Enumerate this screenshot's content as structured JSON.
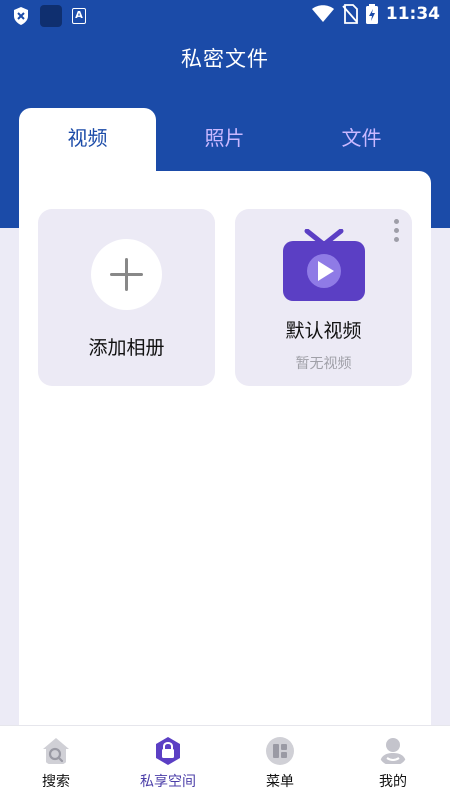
{
  "status_bar": {
    "time": "11:34",
    "icons": [
      "shield-x-icon",
      "app-square-icon",
      "a-box-icon",
      "wifi-icon",
      "no-sim-icon",
      "battery-charging-icon"
    ]
  },
  "header": {
    "title": "私密文件"
  },
  "tabs": [
    {
      "label": "视频",
      "active": true
    },
    {
      "label": "照片",
      "active": false
    },
    {
      "label": "文件",
      "active": false
    }
  ],
  "albums": [
    {
      "label": "添加相册",
      "icon": "plus-icon"
    },
    {
      "label": "默认视频",
      "subtitle": "暂无视频",
      "icon": "tv-play-icon"
    }
  ],
  "bottom_nav": [
    {
      "label": "搜索",
      "icon": "search-house-icon",
      "active": false
    },
    {
      "label": "私享空间",
      "icon": "lock-icon",
      "active": true
    },
    {
      "label": "菜单",
      "icon": "menu-grid-icon",
      "active": false
    },
    {
      "label": "我的",
      "icon": "user-icon",
      "active": false
    }
  ],
  "colors": {
    "header_blue": "#1B4BA8",
    "accent_purple": "#5B3FC4",
    "inactive_tab": "#C9B8FF",
    "page_bg": "#ECEBF6"
  }
}
